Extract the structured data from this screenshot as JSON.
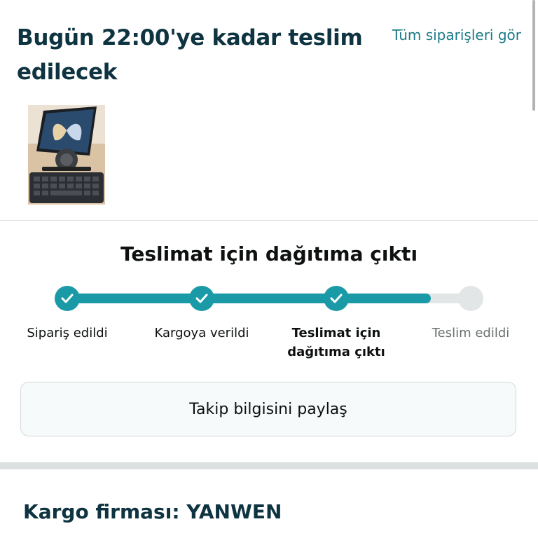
{
  "header": {
    "title": "Bugün 22:00'ye kadar teslim edilecek",
    "all_orders_link": "Tüm siparişleri gör"
  },
  "product": {
    "image_icon": "foldable-phone-keyboard-image"
  },
  "tracking": {
    "status_title": "Teslimat için dağıtıma çıktı",
    "progress_fraction": 0.9,
    "steps": [
      {
        "label": "Sipariş edildi",
        "state": "done"
      },
      {
        "label": "Kargoya verildi",
        "state": "done"
      },
      {
        "label": "Teslimat için dağıtıma çıktı",
        "state": "current"
      },
      {
        "label": "Teslim edildi",
        "state": "todo"
      }
    ],
    "share_button": "Takip bilgisini paylaş"
  },
  "carrier": {
    "text": "Kargo firması: YANWEN"
  },
  "colors": {
    "accent": "#1a9aa6",
    "link": "#1c7a86",
    "heading": "#0f3441",
    "track_empty": "#e3e6e6"
  }
}
